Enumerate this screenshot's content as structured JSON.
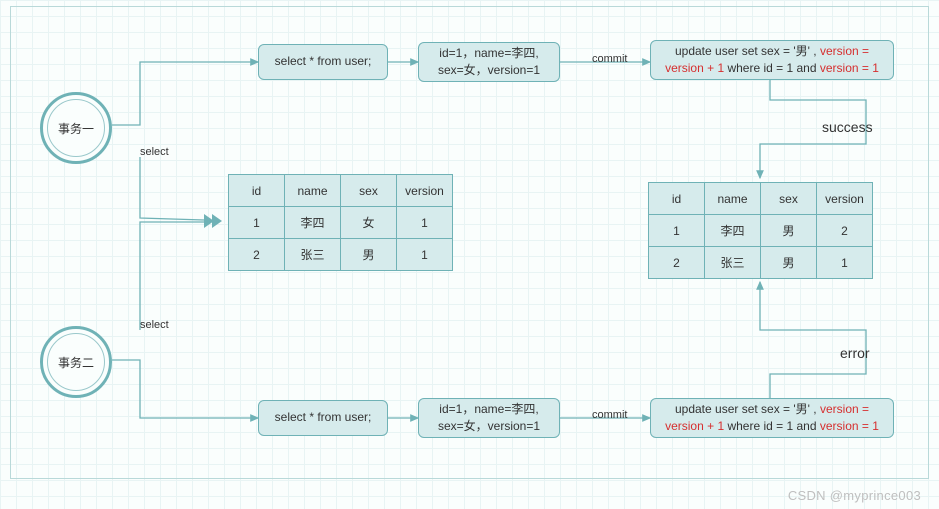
{
  "transactions": {
    "t1": "事务一",
    "t2": "事务二"
  },
  "labels": {
    "select": "select",
    "commit": "commit",
    "success": "success",
    "error": "error"
  },
  "nodes": {
    "select_top": "select * from user;",
    "select_bottom": "select * from user;",
    "result_top_line1": "id=1，name=李四,",
    "result_top_line2": "sex=女，version=1",
    "result_bottom_line1": "id=1，name=李四,",
    "result_bottom_line2": "sex=女，version=1",
    "update_top_pre": "update user set sex = '男' , ",
    "update_top_red1": "version = version + 1",
    "update_top_mid": " where id = 1 and ",
    "update_top_red2": "version = 1",
    "update_bottom_pre": "update user set sex = '男' , ",
    "update_bottom_red1": "version = version + 1",
    "update_bottom_mid": " where id = 1 and ",
    "update_bottom_red2": "version = 1"
  },
  "table_before": {
    "headers": [
      "id",
      "name",
      "sex",
      "version"
    ],
    "rows": [
      [
        "1",
        "李四",
        "女",
        "1"
      ],
      [
        "2",
        "张三",
        "男",
        "1"
      ]
    ]
  },
  "table_after": {
    "headers": [
      "id",
      "name",
      "sex",
      "version"
    ],
    "rows": [
      [
        "1",
        "李四",
        "男",
        "2"
      ],
      [
        "2",
        "张三",
        "男",
        "1"
      ]
    ]
  },
  "watermark": "CSDN @myprince003"
}
